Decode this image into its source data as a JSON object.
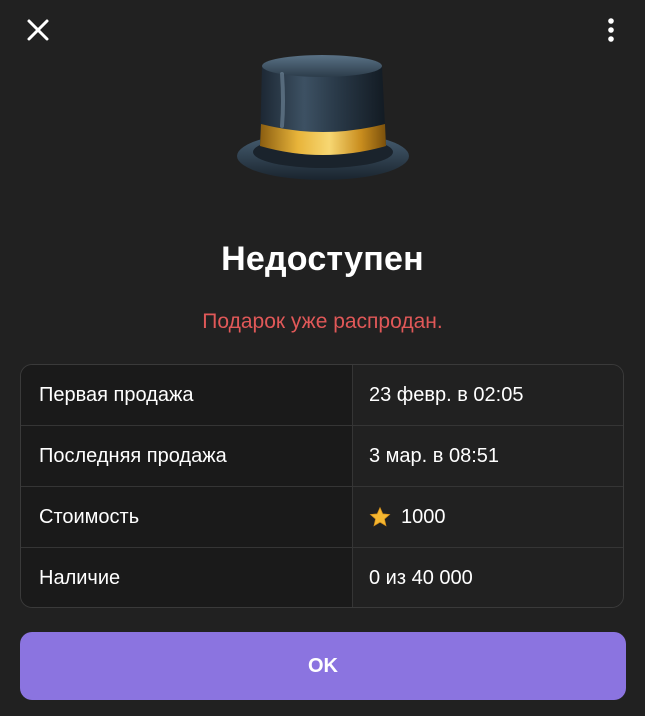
{
  "header": {
    "close_icon": "close-icon",
    "menu_icon": "more-vertical-icon"
  },
  "gift": {
    "image": "top-hat-icon",
    "title": "Недоступен",
    "status": "Подарок уже распродан."
  },
  "details": {
    "rows": [
      {
        "label": "Первая продажа",
        "value": "23 февр. в 02:05"
      },
      {
        "label": "Последняя продажа",
        "value": "3 мар. в 08:51"
      },
      {
        "label": "Стоимость",
        "value": "1000",
        "icon": "star-icon"
      },
      {
        "label": "Наличие",
        "value": "0 из 40 000"
      }
    ]
  },
  "footer": {
    "ok_label": "OK"
  },
  "colors": {
    "background": "#212121",
    "status_text": "#e05858",
    "accent_button": "#8b74e0",
    "star": "#f5b731"
  }
}
